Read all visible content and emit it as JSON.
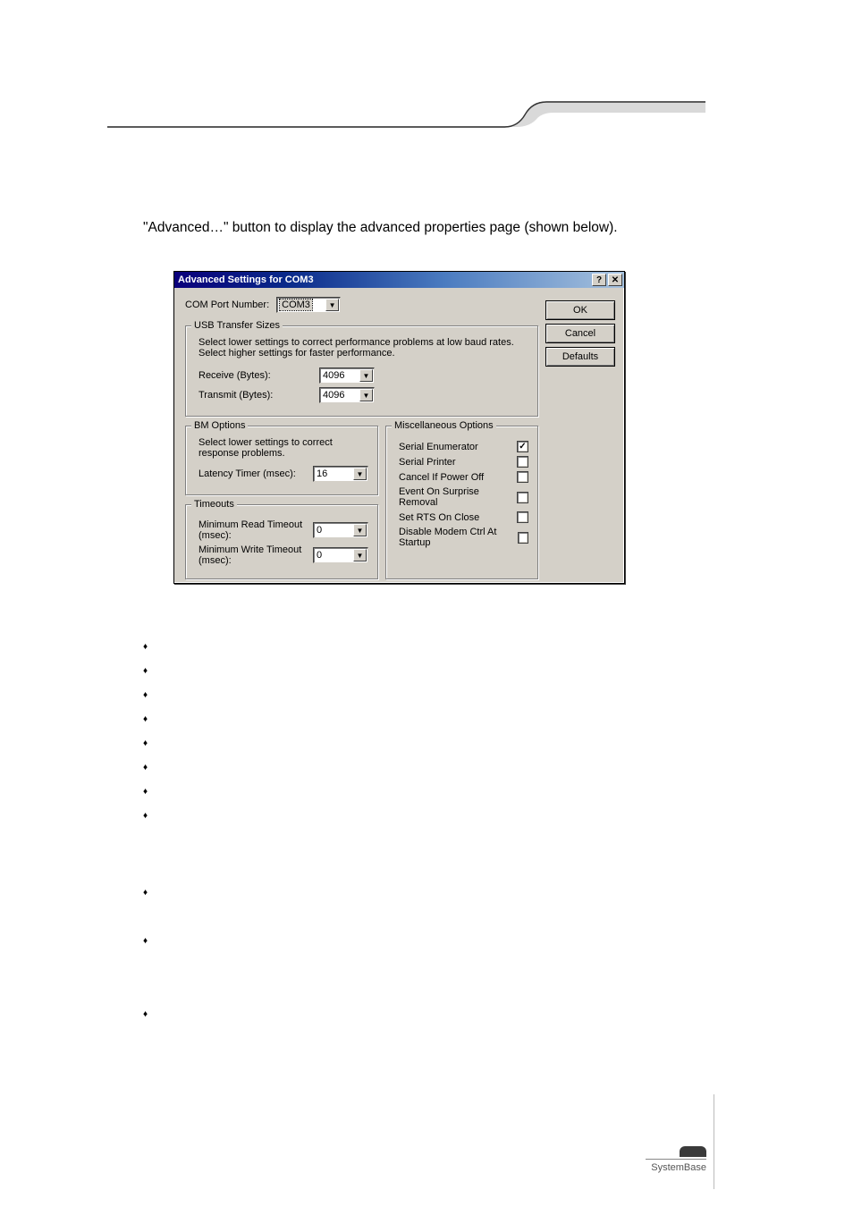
{
  "page": {
    "intro_text": "\"Advanced…\" button to display the advanced properties page (shown below)."
  },
  "dialog": {
    "title": "Advanced Settings for COM3",
    "help_glyph": "?",
    "close_glyph": "✕",
    "com_port_label": "COM Port Number:",
    "com_port_value": "COM3",
    "buttons": {
      "ok": "OK",
      "cancel": "Cancel",
      "defaults": "Defaults"
    },
    "usb_group": {
      "legend": "USB Transfer Sizes",
      "hint1": "Select lower settings to correct performance problems at low baud rates.",
      "hint2": "Select higher settings for faster performance.",
      "receive_label": "Receive (Bytes):",
      "receive_value": "4096",
      "transmit_label": "Transmit (Bytes):",
      "transmit_value": "4096"
    },
    "bm_group": {
      "legend": "BM Options",
      "hint": "Select lower settings to correct response problems.",
      "latency_label": "Latency Timer (msec):",
      "latency_value": "16"
    },
    "timeouts_group": {
      "legend": "Timeouts",
      "min_read_label": "Minimum Read Timeout (msec):",
      "min_read_value": "0",
      "min_write_label": "Minimum Write Timeout (msec):",
      "min_write_value": "0"
    },
    "misc_group": {
      "legend": "Miscellaneous Options",
      "items": [
        {
          "label": "Serial Enumerator",
          "checked": true
        },
        {
          "label": "Serial Printer",
          "checked": false
        },
        {
          "label": "Cancel If Power Off",
          "checked": false
        },
        {
          "label": "Event On Surprise Removal",
          "checked": false
        },
        {
          "label": "Set RTS On Close",
          "checked": false
        },
        {
          "label": "Disable Modem Ctrl At Startup",
          "checked": false
        }
      ]
    }
  },
  "footer": {
    "brand": "SystemBase"
  }
}
